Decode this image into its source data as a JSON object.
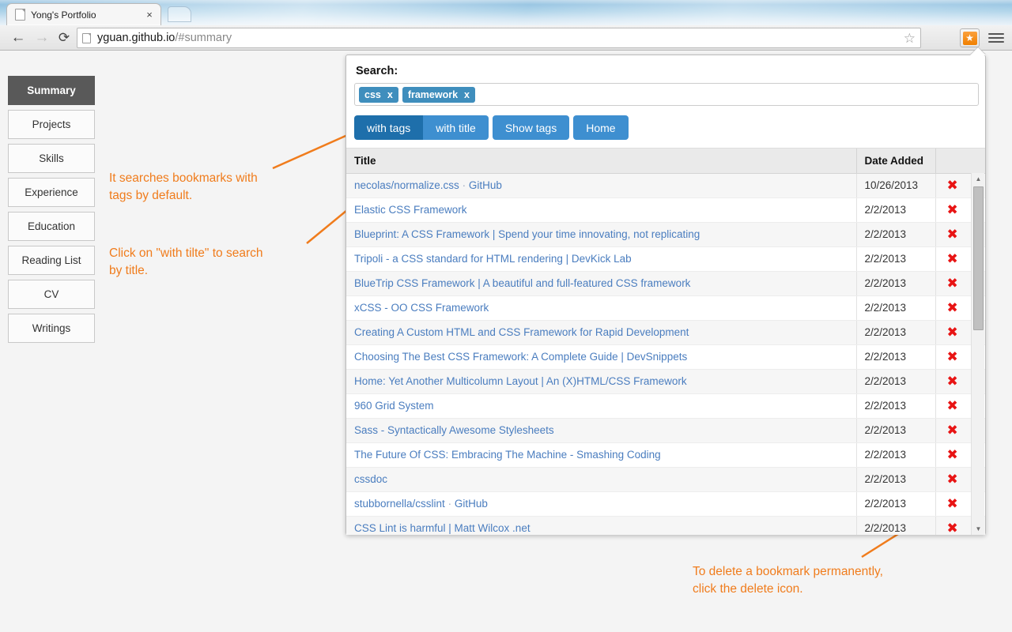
{
  "browser": {
    "tab_title": "Yong's Portfolio",
    "tab_close": "×",
    "back_icon": "←",
    "forward_icon": "→",
    "reload_icon": "⟳",
    "url_host": "yguan.github.io",
    "url_path": "/#summary",
    "star_icon": "☆",
    "ext_icon": "★"
  },
  "sidebar": {
    "items": [
      {
        "label": "Summary",
        "active": true
      },
      {
        "label": "Projects",
        "active": false
      },
      {
        "label": "Skills",
        "active": false
      },
      {
        "label": "Experience",
        "active": false
      },
      {
        "label": "Education",
        "active": false
      },
      {
        "label": "Reading List",
        "active": false
      },
      {
        "label": "CV",
        "active": false
      },
      {
        "label": "Writings",
        "active": false
      }
    ]
  },
  "annotations": {
    "color": "#f07c1c",
    "note_tags": "It searches bookmarks with\ntags by default.",
    "note_title": "Click on \"with tilte\" to search\nby title.",
    "note_delete": "To delete a bookmark permanently,\nclick the delete icon."
  },
  "popup": {
    "search_label": "Search:",
    "tags": [
      {
        "name": "css",
        "remove": "x"
      },
      {
        "name": "framework",
        "remove": "x"
      }
    ],
    "buttons": [
      {
        "label": "with tags",
        "active": true
      },
      {
        "label": "with title",
        "active": false
      },
      {
        "label": "Show tags",
        "active": false
      },
      {
        "label": "Home",
        "active": false
      }
    ],
    "columns": {
      "title": "Title",
      "date": "Date Added",
      "delete": ""
    },
    "delete_icon": "✖",
    "scroll": {
      "up_icon": "▲",
      "down_icon": "▼"
    },
    "rows": [
      {
        "title": "necolas/normalize.css",
        "sep": " · ",
        "title2": "GitHub",
        "date": "10/26/2013"
      },
      {
        "title": "Elastic CSS Framework",
        "sep": "",
        "title2": "",
        "date": "2/2/2013"
      },
      {
        "title": "Blueprint: A CSS Framework | Spend your time innovating, not replicating",
        "sep": "",
        "title2": "",
        "date": "2/2/2013"
      },
      {
        "title": "Tripoli - a CSS standard for HTML rendering | DevKick Lab",
        "sep": "",
        "title2": "",
        "date": "2/2/2013"
      },
      {
        "title": "BlueTrip CSS Framework | A beautiful and full-featured CSS framework",
        "sep": "",
        "title2": "",
        "date": "2/2/2013"
      },
      {
        "title": "xCSS - OO CSS Framework",
        "sep": "",
        "title2": "",
        "date": "2/2/2013"
      },
      {
        "title": "Creating A Custom HTML and CSS Framework for Rapid Development",
        "sep": "",
        "title2": "",
        "date": "2/2/2013"
      },
      {
        "title": "Choosing The Best CSS Framework: A Complete Guide | DevSnippets",
        "sep": "",
        "title2": "",
        "date": "2/2/2013"
      },
      {
        "title": "Home: Yet Another Multicolumn Layout | An (X)HTML/CSS Framework",
        "sep": "",
        "title2": "",
        "date": "2/2/2013"
      },
      {
        "title": "960 Grid System",
        "sep": "",
        "title2": "",
        "date": "2/2/2013"
      },
      {
        "title": "Sass - Syntactically Awesome Stylesheets",
        "sep": "",
        "title2": "",
        "date": "2/2/2013"
      },
      {
        "title": "The Future Of CSS: Embracing The Machine - Smashing Coding",
        "sep": "",
        "title2": "",
        "date": "2/2/2013"
      },
      {
        "title": "cssdoc",
        "sep": "",
        "title2": "",
        "date": "2/2/2013"
      },
      {
        "title": "stubbornella/csslint",
        "sep": " · ",
        "title2": "GitHub",
        "date": "2/2/2013"
      },
      {
        "title": "CSS Lint is harmful | Matt Wilcox .net",
        "sep": "",
        "title2": "",
        "date": "2/2/2013"
      }
    ]
  }
}
